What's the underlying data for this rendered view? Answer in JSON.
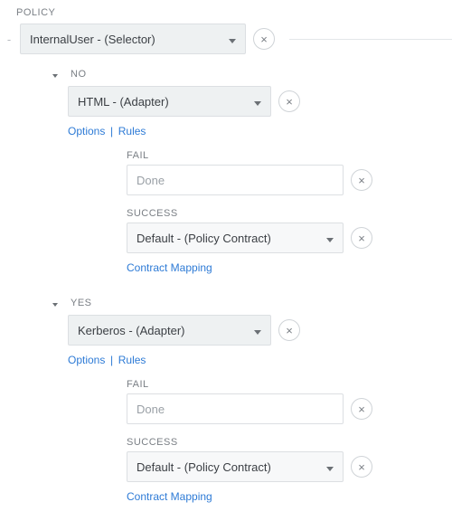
{
  "policy": {
    "title": "POLICY",
    "selector": "InternalUser - (Selector)"
  },
  "branches": [
    {
      "label": "NO",
      "adapter": "HTML - (Adapter)",
      "links": {
        "options": "Options",
        "rules": "Rules"
      },
      "fail": {
        "label": "FAIL",
        "value": "Done"
      },
      "success": {
        "label": "SUCCESS",
        "value": "Default - (Policy Contract)",
        "mapping": "Contract Mapping"
      }
    },
    {
      "label": "YES",
      "adapter": "Kerberos - (Adapter)",
      "links": {
        "options": "Options",
        "rules": "Rules"
      },
      "fail": {
        "label": "FAIL",
        "value": "Done"
      },
      "success": {
        "label": "SUCCESS",
        "value": "Default - (Policy Contract)",
        "mapping": "Contract Mapping"
      }
    }
  ]
}
